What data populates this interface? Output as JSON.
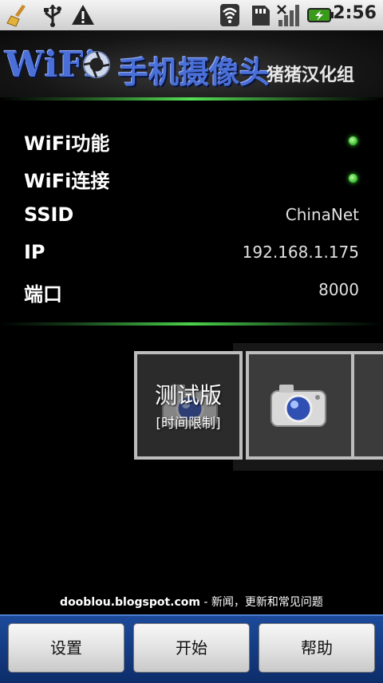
{
  "status_bar": {
    "time": "2:56",
    "icons": [
      "broom-icon",
      "usb-icon",
      "warning-icon",
      "wifi-icon",
      "sd-card-icon",
      "signal-icon",
      "battery-charging-icon"
    ]
  },
  "banner": {
    "title_wifi": "WiFi",
    "title_cn": "手机摄像头",
    "credit": "猪猪汉化组"
  },
  "info": {
    "rows": [
      {
        "label": "WiFi功能",
        "indicator": "on"
      },
      {
        "label": "WiFi连接",
        "indicator": "on"
      },
      {
        "label": "SSID",
        "value": "ChinaNet"
      },
      {
        "label": "IP",
        "value": "192.168.1.175"
      },
      {
        "label": "端口",
        "value": "8000"
      }
    ]
  },
  "carousel": {
    "trial_title": "测试版",
    "trial_sub": "[时间限制]"
  },
  "footer": {
    "site": "dooblou.blogspot.com",
    "rest": " - 新闻，更新和常见问题"
  },
  "buttons": {
    "settings": "设置",
    "start": "开始",
    "help": "帮助"
  },
  "colors": {
    "accent_green": "#4ad24a",
    "title_blue": "#4a70d8",
    "bottom_bar": "#1c4a9a"
  }
}
